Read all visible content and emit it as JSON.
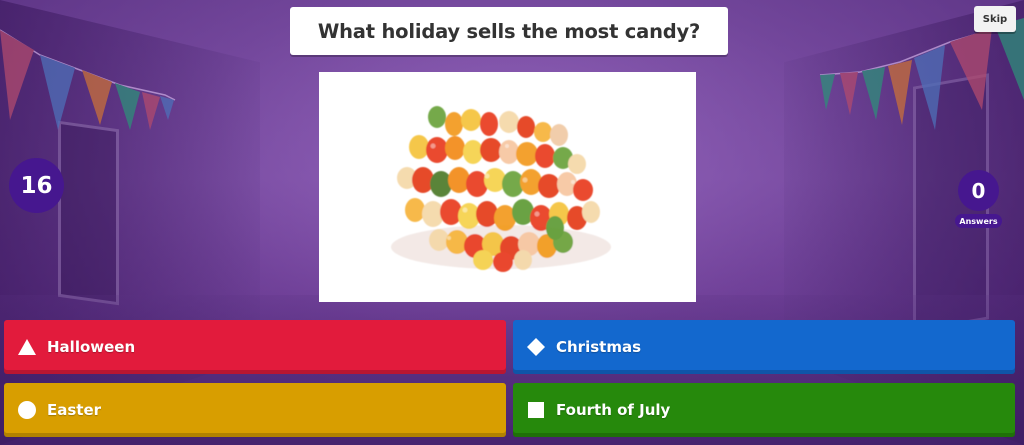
{
  "question": {
    "text": "What holiday sells the most candy?"
  },
  "skip_button": {
    "label": "Skip"
  },
  "timer": {
    "value": "16"
  },
  "answers_counter": {
    "count": "0",
    "label": "Answers"
  },
  "question_image": {
    "alt": "Pile of gummy bears"
  },
  "choices": [
    {
      "label": "Halloween",
      "shape": "triangle-icon",
      "color": "#e21b3c"
    },
    {
      "label": "Christmas",
      "shape": "diamond-icon",
      "color": "#1368ce"
    },
    {
      "label": "Easter",
      "shape": "circle-icon",
      "color": "#d89e00"
    },
    {
      "label": "Fourth of July",
      "shape": "square-icon",
      "color": "#26890c"
    }
  ],
  "colors": {
    "background": "#6a3e93",
    "badge": "#46178f"
  }
}
